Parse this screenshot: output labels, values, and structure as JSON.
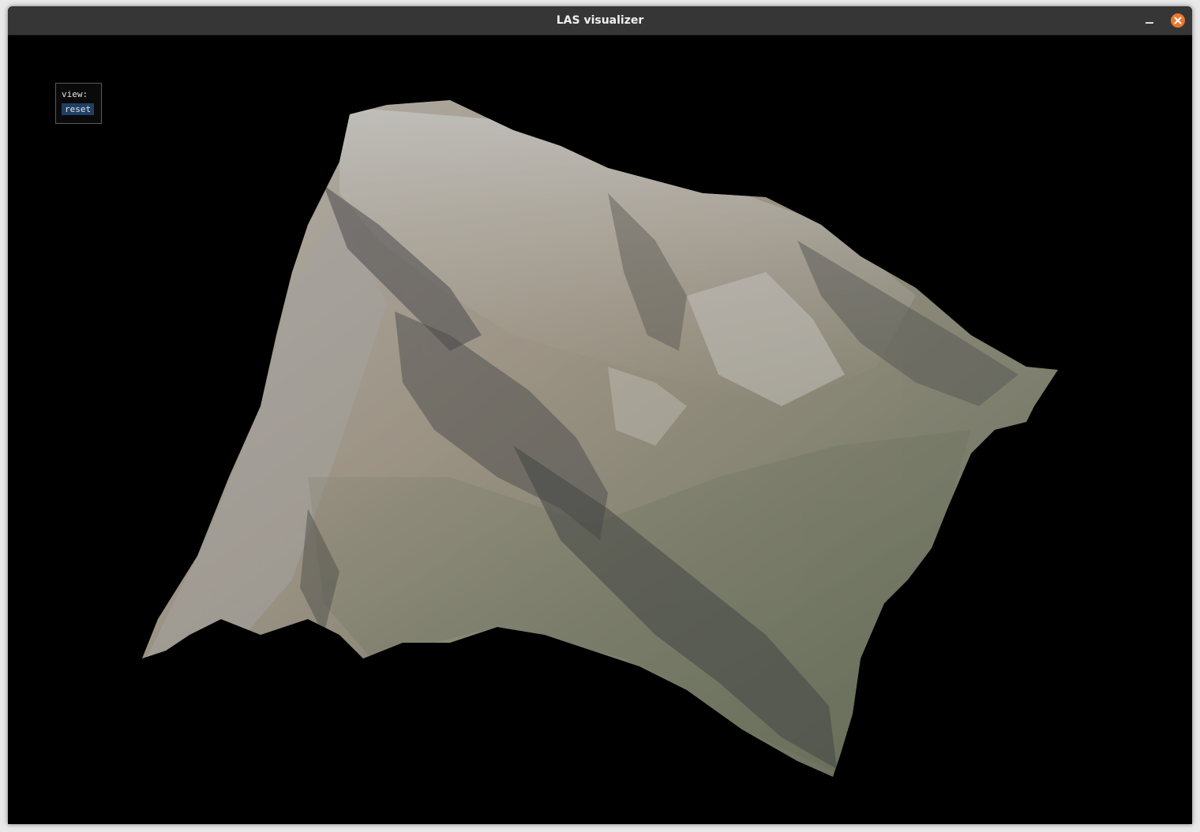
{
  "window": {
    "title": "LAS visualizer",
    "close_icon": "close-icon",
    "minimize_icon": "minimize-icon",
    "accent_color": "#e8782f"
  },
  "view_panel": {
    "label": "view:",
    "reset_label": "reset"
  },
  "scene": {
    "background_color": "#000000",
    "content": "textured 3D point cloud of a mountain terrain"
  }
}
